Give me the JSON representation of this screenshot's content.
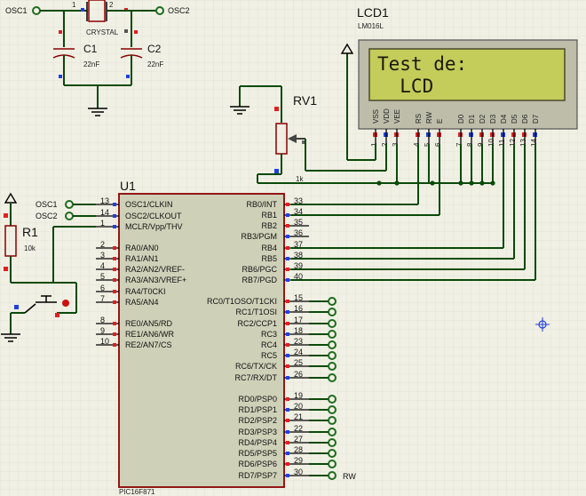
{
  "colors": {
    "background": "#f0f0e4",
    "grid": "#d8d8cc",
    "wire": "#0a4a0a",
    "component_outline": "#8b0000",
    "chip_fill": "#cfd0b8",
    "lcd_screen": "#c4cc5a",
    "lcd_bezel": "#bdbdaa",
    "pin_high": "#e02020",
    "pin_low": "#2040e0",
    "terminal": "#1e6b1e"
  },
  "crystal": {
    "name": "CRYSTAL",
    "left_label": "OSC1",
    "right_label": "OSC2",
    "pin_left": "1",
    "pin_right": "2"
  },
  "c1": {
    "name": "C1",
    "value": "22nF"
  },
  "c2": {
    "name": "C2",
    "value": "22nF"
  },
  "lcd": {
    "name": "LCD1",
    "model": "LM016L",
    "line1": "Test de:",
    "line2": "  LCD",
    "pins": [
      {
        "name": "VSS",
        "num": "1"
      },
      {
        "name": "VDD",
        "num": "2"
      },
      {
        "name": "VEE",
        "num": "3"
      },
      {
        "name": "RS",
        "num": "4"
      },
      {
        "name": "RW",
        "num": "5"
      },
      {
        "name": "E",
        "num": "6"
      },
      {
        "name": "D0",
        "num": "7"
      },
      {
        "name": "D1",
        "num": "8"
      },
      {
        "name": "D2",
        "num": "9"
      },
      {
        "name": "D3",
        "num": "10"
      },
      {
        "name": "D4",
        "num": "11"
      },
      {
        "name": "D5",
        "num": "12"
      },
      {
        "name": "D6",
        "num": "13"
      },
      {
        "name": "D7",
        "num": "14"
      }
    ]
  },
  "rv1": {
    "name": "RV1",
    "value": "1k"
  },
  "r1": {
    "name": "R1",
    "value": "10k"
  },
  "osc_terms": {
    "osc1": "OSC1",
    "osc2": "OSC2"
  },
  "chip": {
    "name": "U1",
    "model": "PIC16F871",
    "left_pins": [
      {
        "num": "13",
        "label": "OSC1/CLKIN"
      },
      {
        "num": "14",
        "label": "OSC2/CLKOUT"
      },
      {
        "num": "1",
        "label": "MCLR/Vpp/THV"
      },
      {
        "num": "2",
        "label": "RA0/AN0"
      },
      {
        "num": "3",
        "label": "RA1/AN1"
      },
      {
        "num": "4",
        "label": "RA2/AN2/VREF-"
      },
      {
        "num": "5",
        "label": "RA3/AN3/VREF+"
      },
      {
        "num": "6",
        "label": "RA4/T0CKI"
      },
      {
        "num": "7",
        "label": "RA5/AN4"
      },
      {
        "num": "8",
        "label": "RE0/AN5/RD"
      },
      {
        "num": "9",
        "label": "RE1/AN6/WR"
      },
      {
        "num": "10",
        "label": "RE2/AN7/CS"
      }
    ],
    "right_pins": [
      {
        "num": "33",
        "label": "RB0/INT"
      },
      {
        "num": "34",
        "label": "RB1"
      },
      {
        "num": "35",
        "label": "RB2"
      },
      {
        "num": "36",
        "label": "RB3/PGM"
      },
      {
        "num": "37",
        "label": "RB4"
      },
      {
        "num": "38",
        "label": "RB5"
      },
      {
        "num": "39",
        "label": "RB6/PGC"
      },
      {
        "num": "40",
        "label": "RB7/PGD"
      },
      {
        "num": "15",
        "label": "RC0/T1OSO/T1CKI"
      },
      {
        "num": "16",
        "label": "RC1/T1OSI"
      },
      {
        "num": "17",
        "label": "RC2/CCP1"
      },
      {
        "num": "18",
        "label": "RC3"
      },
      {
        "num": "23",
        "label": "RC4"
      },
      {
        "num": "24",
        "label": "RC5"
      },
      {
        "num": "25",
        "label": "RC6/TX/CK"
      },
      {
        "num": "26",
        "label": "RC7/RX/DT"
      },
      {
        "num": "19",
        "label": "RD0/PSP0"
      },
      {
        "num": "20",
        "label": "RD1/PSP1"
      },
      {
        "num": "21",
        "label": "RD2/PSP2"
      },
      {
        "num": "22",
        "label": "RD3/PSP3"
      },
      {
        "num": "27",
        "label": "RD4/PSP4"
      },
      {
        "num": "28",
        "label": "RD5/PSP5"
      },
      {
        "num": "29",
        "label": "RD6/PSP6"
      },
      {
        "num": "30",
        "label": "RD7/PSP7"
      }
    ]
  },
  "rw_label": "RW"
}
